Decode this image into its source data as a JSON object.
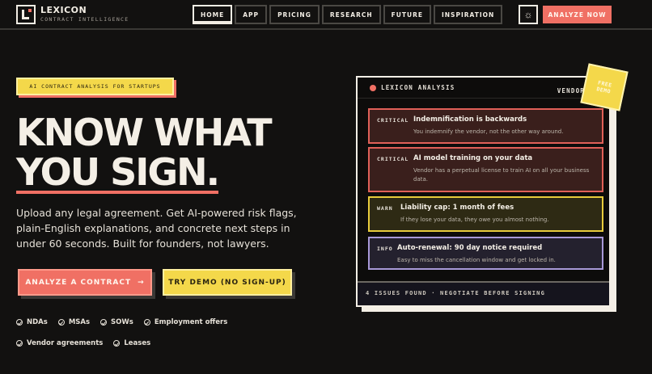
{
  "nav": {
    "brand": "LEXICON",
    "tagline": "CONTRACT INTELLIGENCE",
    "links": [
      "HOME",
      "APP",
      "PRICING",
      "RESEARCH",
      "FUTURE",
      "INSPIRATION"
    ],
    "active_link": "HOME",
    "theme_icon": "sun-icon",
    "cta": "ANALYZE NOW"
  },
  "hero": {
    "badge": "AI CONTRACT ANALYSIS FOR STARTUPS",
    "headline_line1": "KNOW WHAT",
    "headline_line2": "YOU SIGN.",
    "lead": "Upload any legal agreement. Get AI-powered risk flags, plain-English explanations, and concrete next steps in under 60 seconds. Built for founders, not lawyers.",
    "primary_button": "ANALYZE A CONTRACT",
    "primary_arrow": "→",
    "secondary_button": "TRY DEMO (NO SIGN-UP)",
    "document_types": [
      "NDAs",
      "MSAs",
      "SOWs",
      "Employment offers",
      "Vendor agreements",
      "Leases"
    ]
  },
  "analysis": {
    "title": "LEXICON ANALYSIS",
    "document": "VENDOR",
    "sticker": "FREE\nDEMO",
    "issues": [
      {
        "severity": "CRITICAL",
        "title": "Indemnification is backwards",
        "detail": "You indemnify the vendor, not the other way around."
      },
      {
        "severity": "CRITICAL",
        "title": "AI model training on your data",
        "detail": "Vendor has a perpetual license to train AI on all your business data."
      },
      {
        "severity": "WARN",
        "title": "Liability cap: 1 month of fees",
        "detail": "If they lose your data, they owe you almost nothing."
      },
      {
        "severity": "INFO",
        "title": "Auto-renewal: 90 day notice required",
        "detail": "Easy to miss the cancellation window and get locked in."
      }
    ],
    "summary": "4 ISSUES FOUND · NEGOTIATE BEFORE SIGNING"
  },
  "colors": {
    "background": "#121110",
    "accent_coral": "#f07064",
    "accent_yellow": "#f4d84a",
    "critical": "#e06058",
    "warn": "#e8cc3c",
    "info": "#a899d8"
  }
}
